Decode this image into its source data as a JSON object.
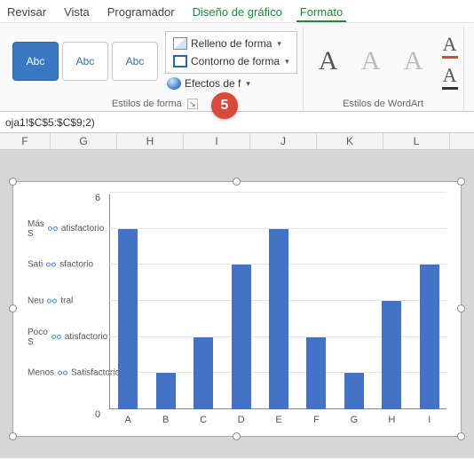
{
  "tabs": {
    "revisar": "Revisar",
    "vista": "Vista",
    "programador": "Programador",
    "diseno": "Diseño de gráfico",
    "formato": "Formato"
  },
  "ribbon": {
    "shape_sample": "Abc",
    "fill_label": "Relleno de forma",
    "outline_label": "Contorno de forma",
    "effects_label": "Efectos de f",
    "group_shape": "Estilos de forma",
    "group_wordart": "Estilos de WordArt",
    "wa_glyph": "A",
    "underline_glyph": "A"
  },
  "step_badge": "5",
  "formula": "oja1!$C$5:$C$9;2)",
  "columns": [
    "F",
    "G",
    "H",
    "I",
    "J",
    "K",
    "L"
  ],
  "chart_data": {
    "type": "bar",
    "categories": [
      "A",
      "B",
      "C",
      "D",
      "E",
      "F",
      "G",
      "H",
      "I"
    ],
    "values": [
      5,
      1,
      2,
      4,
      5,
      2,
      1,
      3,
      4
    ],
    "y_numeric_top": "6",
    "y_numeric_bottom": "0",
    "y_custom_labels": [
      "Más Satisfactorio",
      "Satisfactorio",
      "Neutral",
      "Poco Satisfactorio",
      "Menos Satisfactorio"
    ],
    "ylim": [
      0,
      6
    ],
    "title": "",
    "xlabel": "",
    "ylabel": ""
  }
}
